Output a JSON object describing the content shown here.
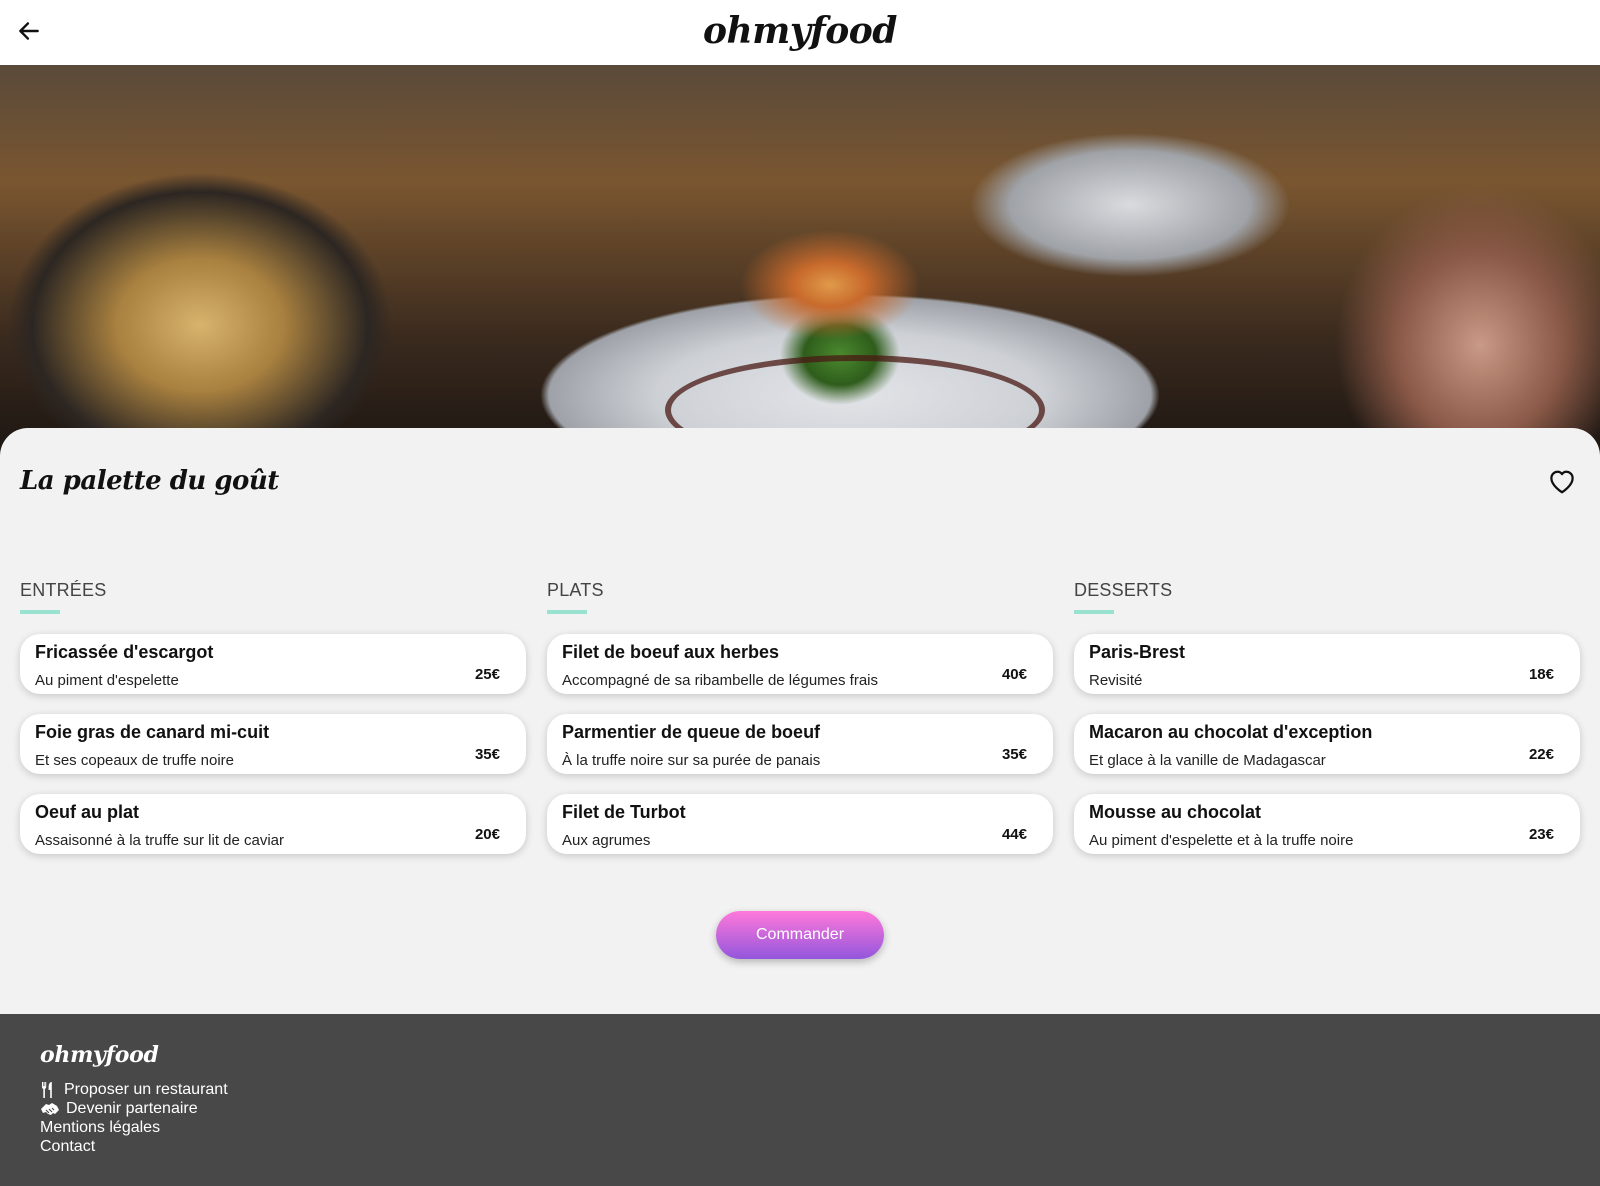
{
  "header": {
    "logo": "ohmyfood",
    "back_icon": "arrow-left-icon"
  },
  "restaurant": {
    "name": "La palette du goût",
    "favorite_icon": "heart-outline-icon"
  },
  "menu": {
    "entrees": {
      "heading": "ENTRÉES",
      "items": [
        {
          "name": "Fricassée d'escargot",
          "description": "Au piment d'espelette",
          "price": "25€"
        },
        {
          "name": "Foie gras de canard mi-cuit",
          "description": "Et ses copeaux de truffe noire",
          "price": "35€"
        },
        {
          "name": "Oeuf au plat",
          "description": "Assaisonné à la truffe sur lit de caviar",
          "price": "20€"
        }
      ]
    },
    "plats": {
      "heading": "PLATS",
      "items": [
        {
          "name": "Filet de boeuf aux herbes",
          "description": "Accompagné de sa ribambelle de légumes frais",
          "price": "40€"
        },
        {
          "name": "Parmentier de queue de boeuf",
          "description": "À la truffe noire sur sa purée de panais",
          "price": "35€"
        },
        {
          "name": "Filet de Turbot",
          "description": "Aux agrumes",
          "price": "44€"
        }
      ]
    },
    "desserts": {
      "heading": "DESSERTS",
      "items": [
        {
          "name": "Paris-Brest",
          "description": "Revisité",
          "price": "18€"
        },
        {
          "name": "Macaron au chocolat d'exception",
          "description": "Et glace à la vanille de Madagascar",
          "price": "22€"
        },
        {
          "name": "Mousse au chocolat",
          "description": "Au piment d'espelette et à la truffe noire",
          "price": "23€"
        }
      ]
    }
  },
  "order_button": "Commander",
  "footer": {
    "logo": "ohmyfood",
    "links": [
      {
        "label": "Proposer un restaurant",
        "icon": "utensils-icon"
      },
      {
        "label": "Devenir partenaire",
        "icon": "handshake-icon"
      },
      {
        "label": "Mentions légales",
        "icon": ""
      },
      {
        "label": "Contact",
        "icon": ""
      }
    ]
  },
  "colors": {
    "accent_underline": "#99e2d0",
    "button_gradient_start": "#ff79da",
    "button_gradient_end": "#9356dc",
    "footer_bg": "#484848",
    "page_bg": "#f2f2f2"
  }
}
